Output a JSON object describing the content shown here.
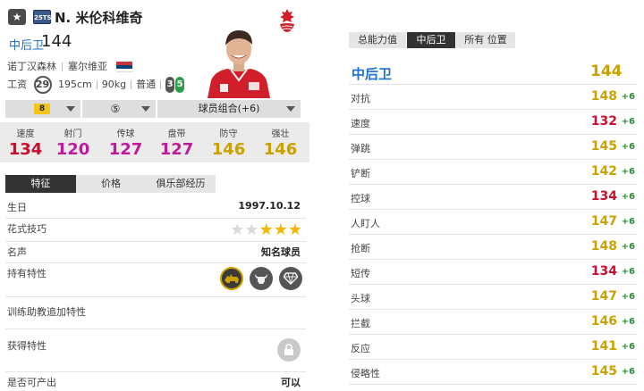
{
  "header": {
    "rank_icon": "star-icon",
    "season_badge": "25TS",
    "player_name": "N. 米伦科维奇",
    "position": "中后卫",
    "overall": "144",
    "club": "诺丁汉森林",
    "nation": "塞尔维亚",
    "wage_label": "工资",
    "wage": "29",
    "height": "195cm",
    "weight": "90kg",
    "body_type": "普通",
    "weak_foot": "3",
    "strong_foot": "5",
    "club_logo": "nottingham-forest-crest-icon"
  },
  "controls": {
    "level": "8",
    "enhance": "⑤",
    "team_color": "球员组合(+6)"
  },
  "summary_stats": [
    {
      "label": "速度",
      "value": "134",
      "color": "#c8102e"
    },
    {
      "label": "射门",
      "value": "120",
      "color": "#c0199b"
    },
    {
      "label": "传球",
      "value": "127",
      "color": "#c0199b"
    },
    {
      "label": "盘带",
      "value": "127",
      "color": "#c0199b"
    },
    {
      "label": "防守",
      "value": "146",
      "color": "#c9a100"
    },
    {
      "label": "强壮",
      "value": "146",
      "color": "#c9a100"
    }
  ],
  "tabs": [
    "特征",
    "价格",
    "俱乐部经历"
  ],
  "info": {
    "birthday_label": "生日",
    "birthday": "1997.10.12",
    "skill_label": "花式技巧",
    "skill_stars": 3,
    "reputation_label": "名声",
    "reputation": "知名球员",
    "traits_label": "持有特性",
    "coach_label": "训练助教追加特性",
    "acquired_label": "获得特性",
    "producible_label": "是否可产出",
    "producible": "可以"
  },
  "right_tabs": [
    "总能力值",
    "中后卫",
    "所有 位置"
  ],
  "right_header": {
    "position": "中后卫",
    "overall": "144"
  },
  "attributes": [
    {
      "name": "对抗",
      "value": "148",
      "bonus": "+6",
      "color": "#c9a100"
    },
    {
      "name": "速度",
      "value": "132",
      "bonus": "+6",
      "color": "#c8102e"
    },
    {
      "name": "弹跳",
      "value": "145",
      "bonus": "+6",
      "color": "#c9a100"
    },
    {
      "name": "铲断",
      "value": "142",
      "bonus": "+6",
      "color": "#c9a100"
    },
    {
      "name": "控球",
      "value": "134",
      "bonus": "+6",
      "color": "#c8102e"
    },
    {
      "name": "人盯人",
      "value": "147",
      "bonus": "+6",
      "color": "#c9a100"
    },
    {
      "name": "抢断",
      "value": "148",
      "bonus": "+6",
      "color": "#c9a100"
    },
    {
      "name": "短传",
      "value": "134",
      "bonus": "+6",
      "color": "#c8102e"
    },
    {
      "name": "头球",
      "value": "147",
      "bonus": "+6",
      "color": "#c9a100"
    },
    {
      "name": "拦截",
      "value": "146",
      "bonus": "+6",
      "color": "#c9a100"
    },
    {
      "name": "反应",
      "value": "141",
      "bonus": "+6",
      "color": "#c9a100"
    },
    {
      "name": "侵略性",
      "value": "145",
      "bonus": "+6",
      "color": "#c9a100"
    }
  ]
}
